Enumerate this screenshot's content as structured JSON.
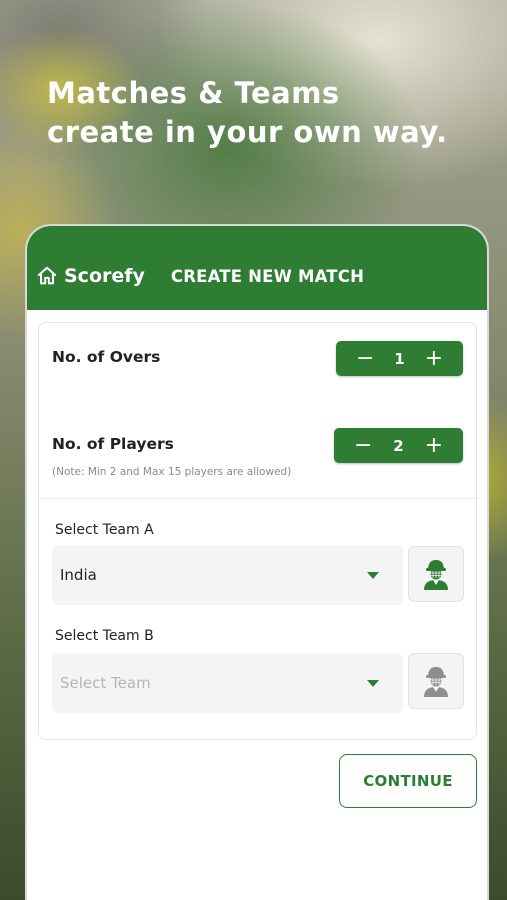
{
  "promo": {
    "line1": "Matches & Teams",
    "line2": "create in your own way."
  },
  "appbar": {
    "brand": "Scorefy",
    "title": "CREATE NEW MATCH",
    "icon": "home-icon"
  },
  "overs": {
    "label": "No. of Overs",
    "value": "1",
    "minus": "−",
    "plus": "+"
  },
  "players": {
    "label": "No. of Players",
    "value": "2",
    "minus": "−",
    "plus": "+",
    "note": "(Note: Min 2 and Max 15 players are allowed)"
  },
  "team_a": {
    "label": "Select Team A",
    "value": "India",
    "avatar_icon": "cricketer-avatar-icon"
  },
  "team_b": {
    "label": "Select Team B",
    "placeholder": "Select Team",
    "avatar_icon": "cricketer-avatar-icon"
  },
  "continue_label": "CONTINUE",
  "colors": {
    "primary": "#2e7d32",
    "avatar_active": "#2e7d32",
    "avatar_inactive": "#8e8e8e"
  }
}
